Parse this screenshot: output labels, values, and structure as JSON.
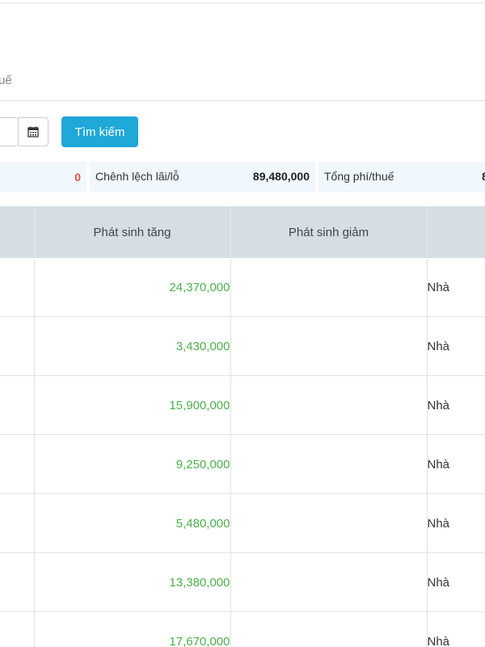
{
  "tab": {
    "partial_label": "uế"
  },
  "toolbar": {
    "calendar_icon": "calendar-icon",
    "search_label": "Tìm kiếm"
  },
  "summary": {
    "first_value": "0",
    "pnl_label": "Chênh lệch lãi/lỗ",
    "pnl_value": "89,480,000",
    "fee_label": "Tổng phí/thuế",
    "fee_value_partial": "8"
  },
  "table": {
    "headers": [
      "",
      "Phát sinh tăng",
      "Phát sinh giảm",
      ""
    ],
    "rows": [
      {
        "increase": "24,370,000",
        "decrease": "",
        "note": "Nhà"
      },
      {
        "increase": "3,430,000",
        "decrease": "",
        "note": "Nhà"
      },
      {
        "increase": "15,900,000",
        "decrease": "",
        "note": "Nhà"
      },
      {
        "increase": "9,250,000",
        "decrease": "",
        "note": "Nhà"
      },
      {
        "increase": "5,480,000",
        "decrease": "",
        "note": "Nhà"
      },
      {
        "increase": "13,380,000",
        "decrease": "",
        "note": "Nhà"
      },
      {
        "increase": "17,670,000",
        "decrease": "",
        "note": "Nhà"
      }
    ]
  },
  "colors": {
    "accent": "#1fa8d8",
    "increase_text": "#4cae4c",
    "negative_text": "#d9534f",
    "header_bg": "#d5dee3",
    "summary_bg": "#f0f7fd"
  }
}
